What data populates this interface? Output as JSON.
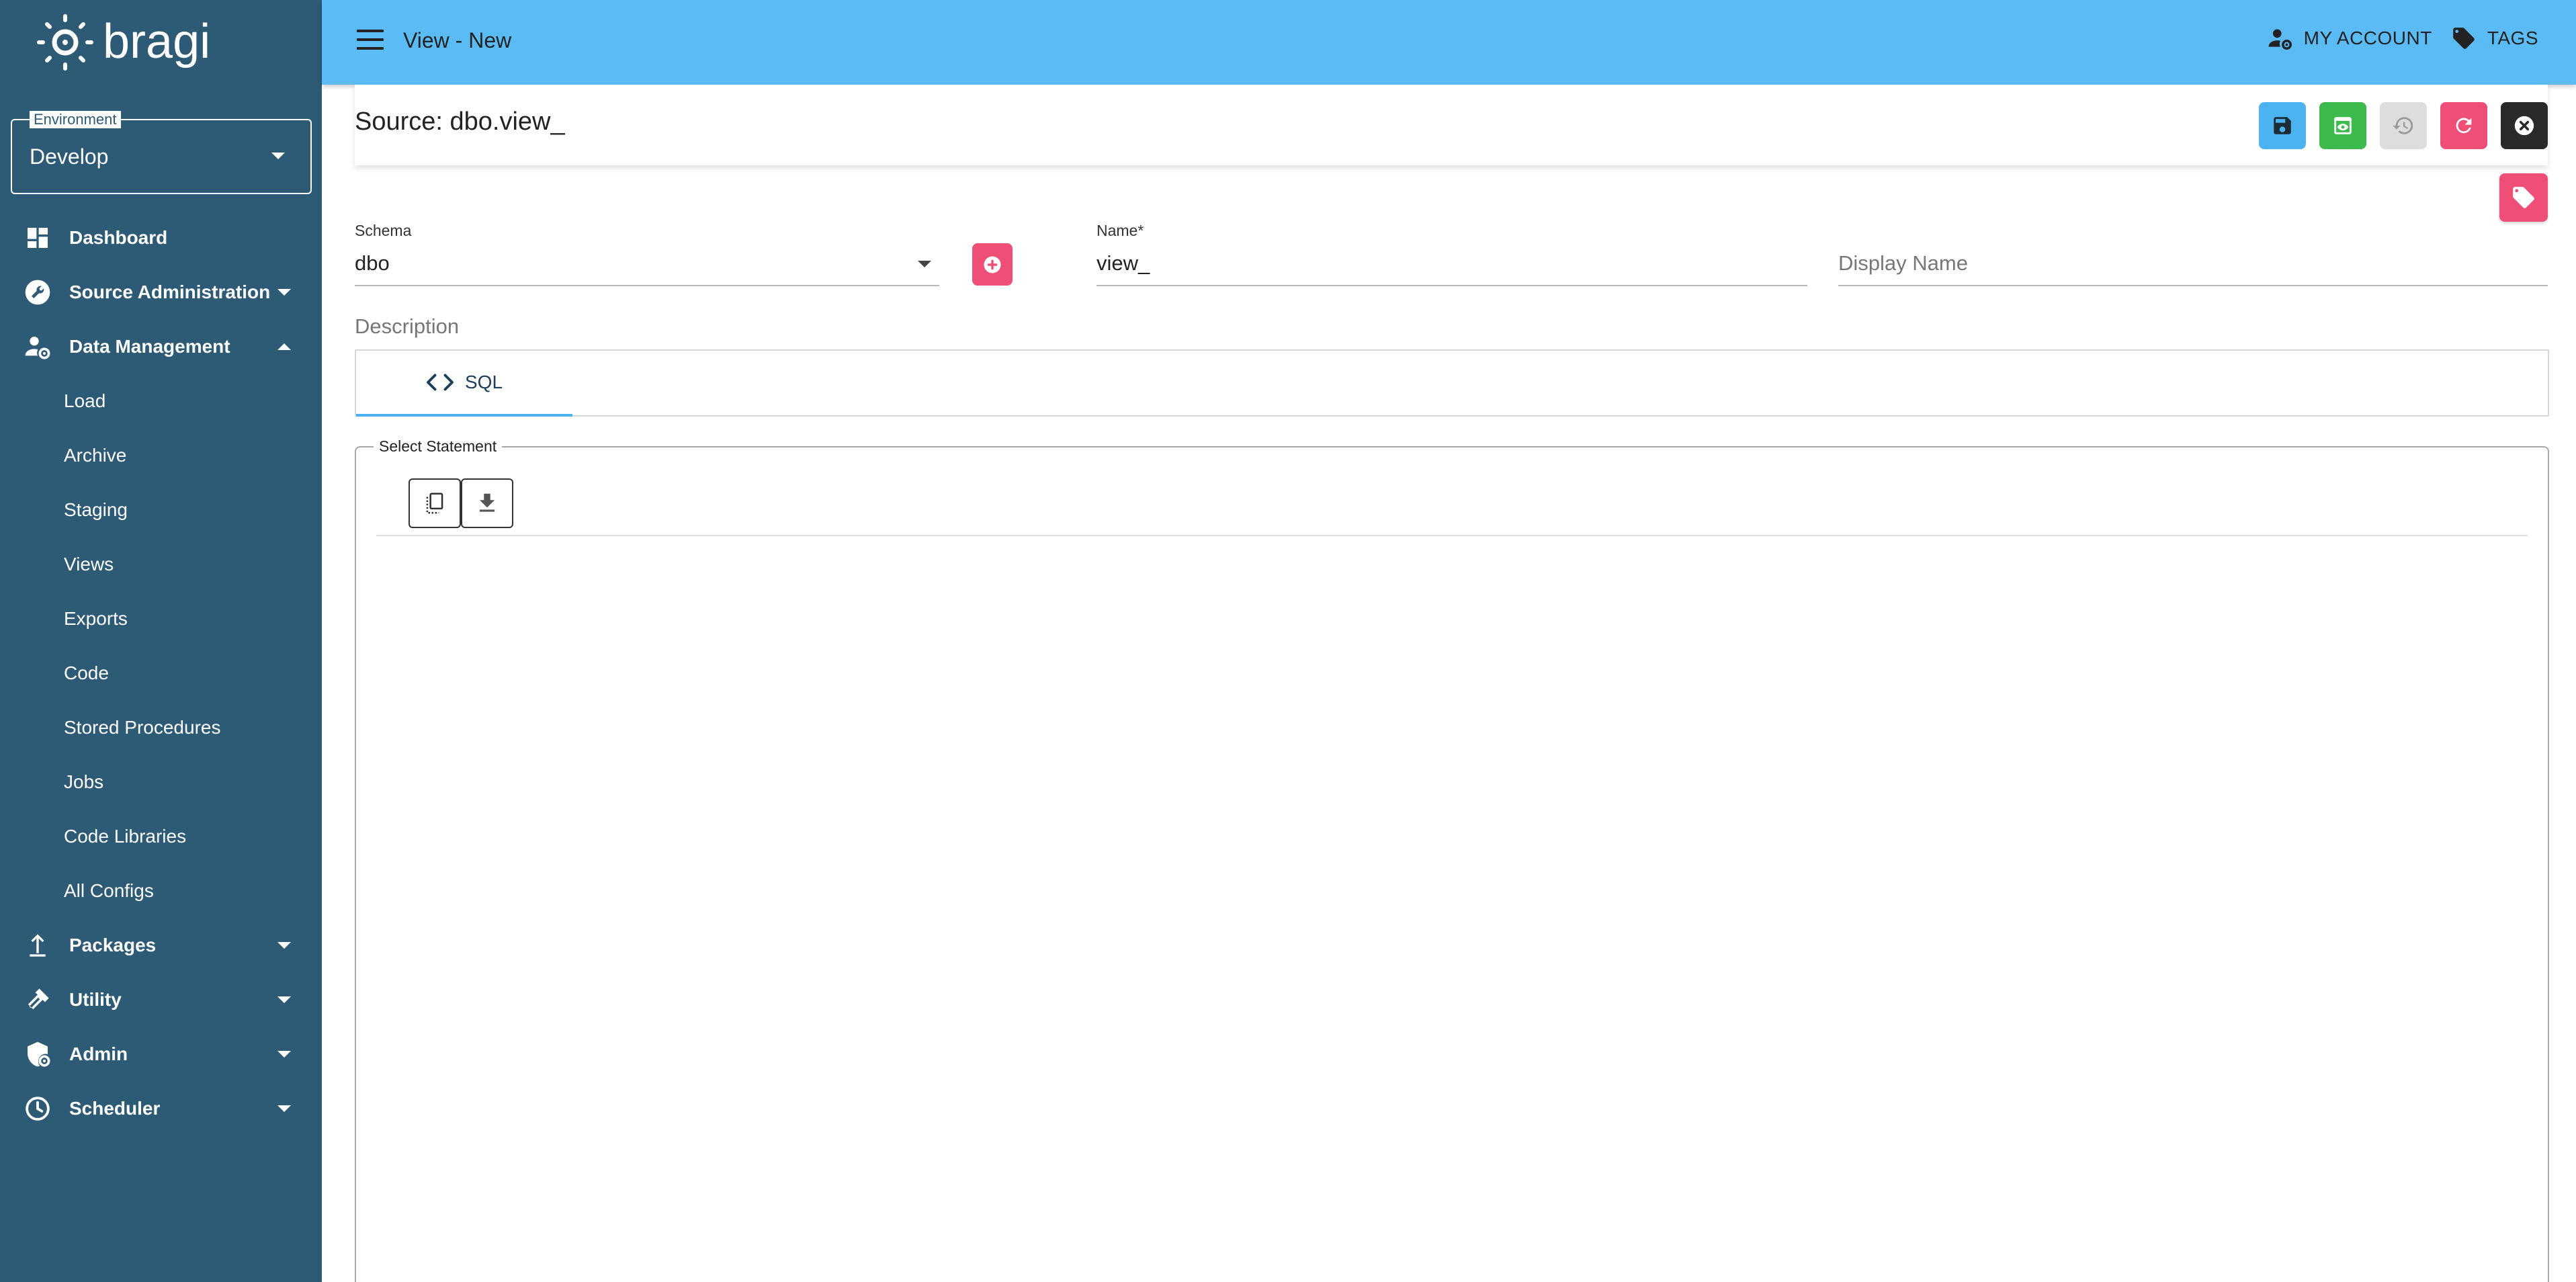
{
  "brand": {
    "logo_text": "bragi"
  },
  "environment": {
    "legend": "Environment",
    "value": "Develop"
  },
  "sidebar": {
    "items": [
      {
        "label": "Dashboard",
        "icon": "dashboard-icon",
        "type": "top"
      },
      {
        "label": "Source Administration",
        "icon": "wrench-icon",
        "type": "group",
        "expanded": false
      },
      {
        "label": "Data Management",
        "icon": "user-gear-icon",
        "type": "group",
        "expanded": true
      },
      {
        "label": "Load",
        "type": "sub"
      },
      {
        "label": "Archive",
        "type": "sub"
      },
      {
        "label": "Staging",
        "type": "sub"
      },
      {
        "label": "Views",
        "type": "sub"
      },
      {
        "label": "Exports",
        "type": "sub"
      },
      {
        "label": "Code",
        "type": "sub"
      },
      {
        "label": "Stored Procedures",
        "type": "sub"
      },
      {
        "label": "Jobs",
        "type": "sub"
      },
      {
        "label": "Code Libraries",
        "type": "sub"
      },
      {
        "label": "All Configs",
        "type": "sub"
      },
      {
        "label": "Packages",
        "icon": "upload-icon",
        "type": "group",
        "expanded": false
      },
      {
        "label": "Utility",
        "icon": "hammer-icon",
        "type": "group",
        "expanded": false
      },
      {
        "label": "Admin",
        "icon": "shield-gear-icon",
        "type": "group",
        "expanded": false
      },
      {
        "label": "Scheduler",
        "icon": "clock-icon",
        "type": "group",
        "expanded": false
      }
    ]
  },
  "topbar": {
    "title": "View - New",
    "my_account": "MY ACCOUNT",
    "tags": "TAGS"
  },
  "source": {
    "title": "Source: dbo.view_"
  },
  "form": {
    "schema_label": "Schema",
    "schema_value": "dbo",
    "name_label": "Name*",
    "name_value": "view_",
    "display_name_placeholder": "Display Name",
    "description_placeholder": "Description"
  },
  "tabs": [
    {
      "label": "SQL",
      "active": true
    }
  ],
  "editor": {
    "legend": "Select Statement"
  },
  "colors": {
    "sidebar_bg": "#2d5a75",
    "topbar_bg": "#5bbcf5",
    "save": "#4ab3f0",
    "preview": "#3dba4e",
    "history": "#dddddd",
    "refresh": "#ef4f76",
    "close": "#2a2a2a",
    "accent_pink": "#ef4f76"
  }
}
